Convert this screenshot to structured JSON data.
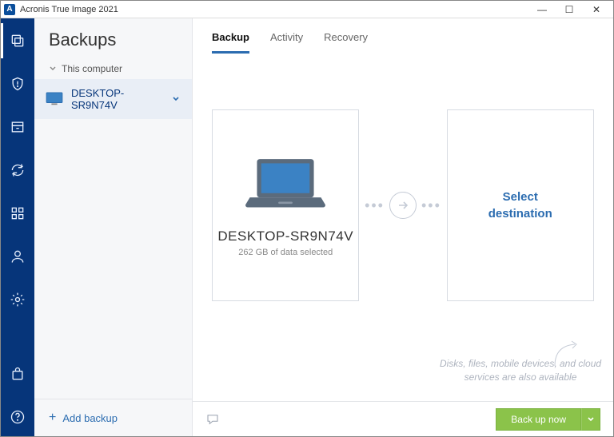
{
  "window": {
    "title": "Acronis True Image 2021"
  },
  "sidebar": {
    "heading": "Backups",
    "group_label": "This computer",
    "item": {
      "label": "DESKTOP-SR9N74V"
    },
    "add_label": "Add backup"
  },
  "tabs": {
    "backup": "Backup",
    "activity": "Activity",
    "recovery": "Recovery"
  },
  "source_card": {
    "title": "DESKTOP-SR9N74V",
    "subtitle": "262 GB of data selected"
  },
  "destination_card": {
    "line1": "Select",
    "line2": "destination"
  },
  "hint": "Disks, files, mobile devices, and cloud services are also available",
  "footer": {
    "backup_now": "Back up now"
  }
}
